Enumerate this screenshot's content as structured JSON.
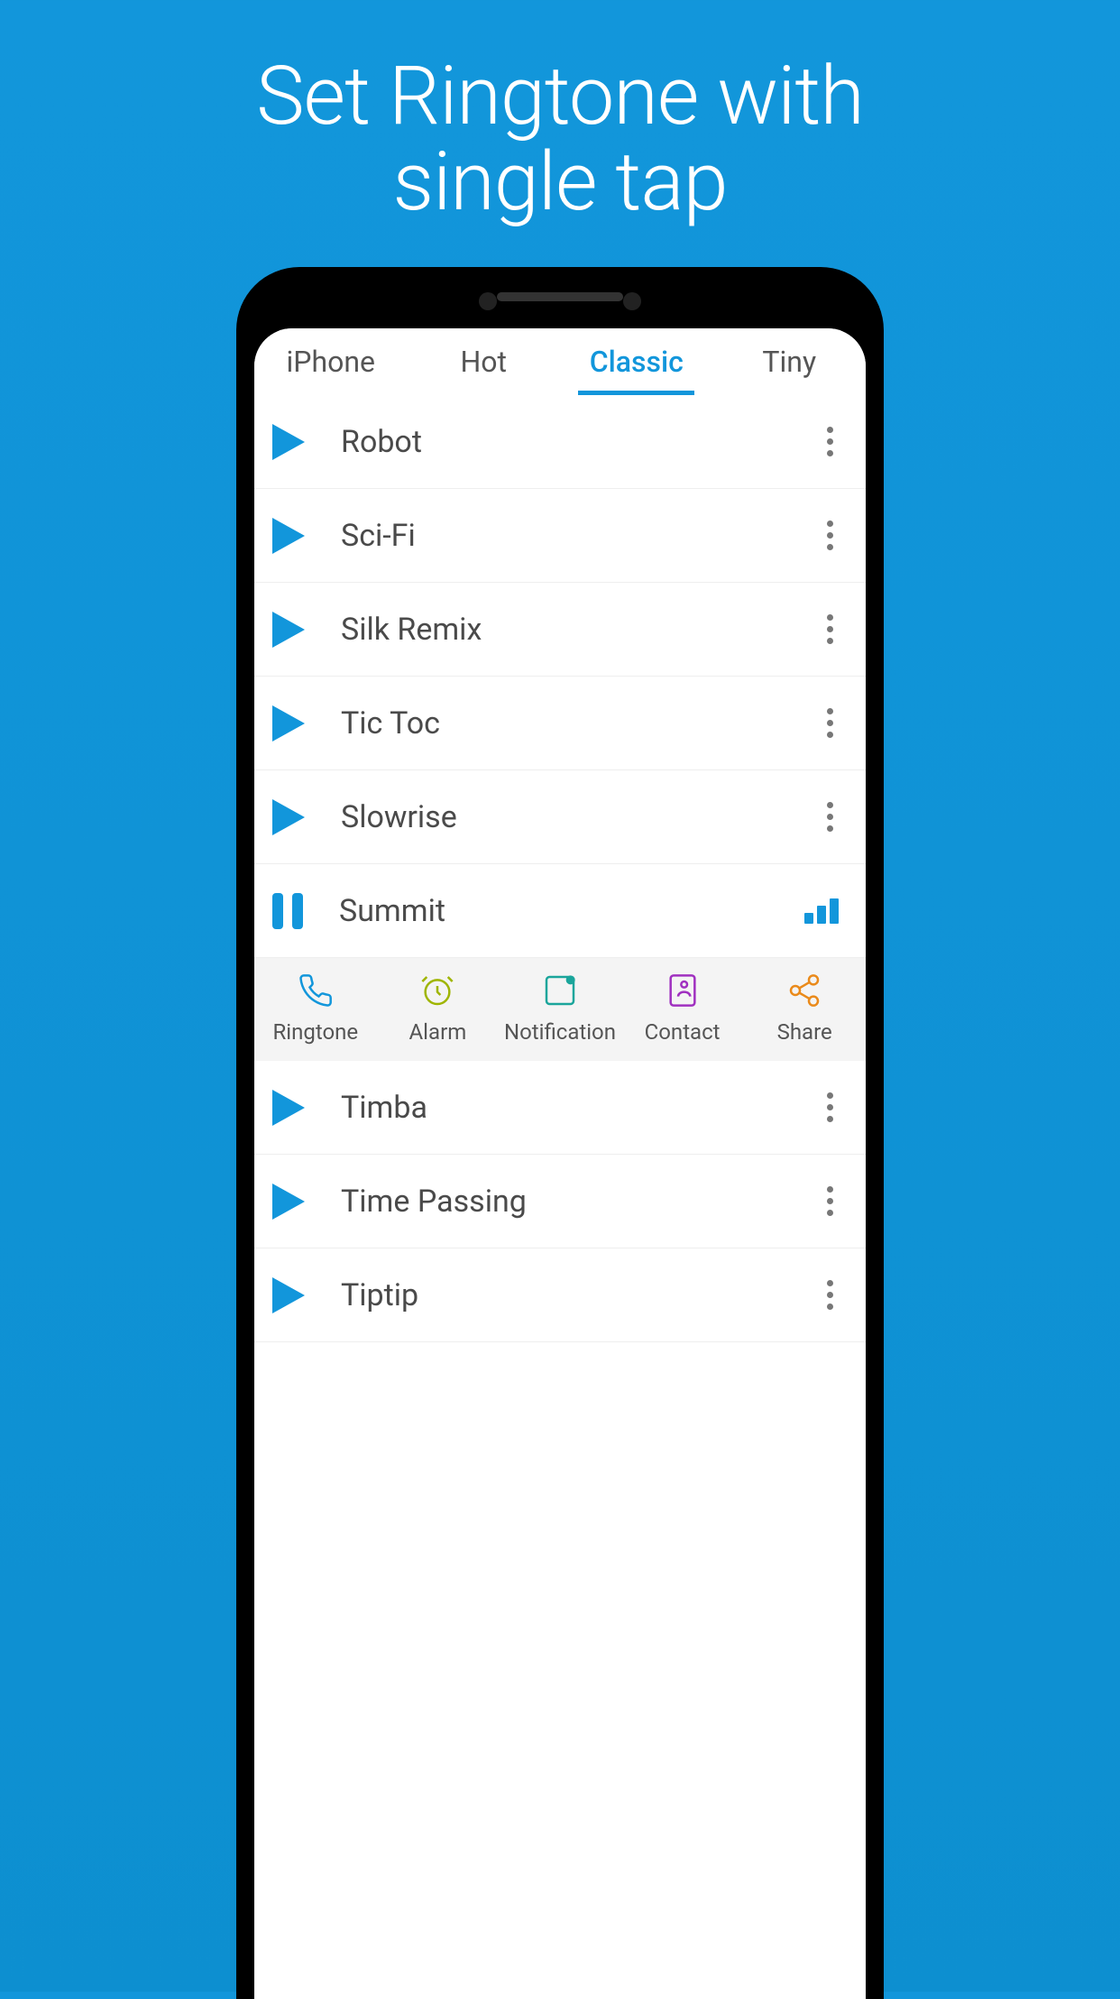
{
  "hero": {
    "line1": "Set Ringtone with",
    "line2": "single tap"
  },
  "tabs": [
    {
      "label": "iPhone",
      "active": false
    },
    {
      "label": "Hot",
      "active": false
    },
    {
      "label": "Classic",
      "active": true
    },
    {
      "label": "Tiny",
      "active": false
    }
  ],
  "tracks_before": [
    {
      "title": "Robot",
      "playing": false
    },
    {
      "title": "Sci-Fi",
      "playing": false
    },
    {
      "title": "Silk Remix",
      "playing": false
    },
    {
      "title": "Tic Toc",
      "playing": false
    },
    {
      "title": "Slowrise",
      "playing": false
    },
    {
      "title": "Summit",
      "playing": true
    }
  ],
  "actions": [
    {
      "label": "Ringtone",
      "icon": "phone-icon",
      "color": "#1296db"
    },
    {
      "label": "Alarm",
      "icon": "alarm-icon",
      "color": "#9fb500"
    },
    {
      "label": "Notification",
      "icon": "notification-icon",
      "color": "#1aa59b"
    },
    {
      "label": "Contact",
      "icon": "contact-icon",
      "color": "#a030c0"
    },
    {
      "label": "Share",
      "icon": "share-icon",
      "color": "#ea8a1a"
    }
  ],
  "tracks_after": [
    {
      "title": "Timba",
      "playing": false
    },
    {
      "title": "Time Passing",
      "playing": false
    },
    {
      "title": "Tiptip",
      "playing": false
    }
  ],
  "colors": {
    "accent": "#1296db"
  }
}
